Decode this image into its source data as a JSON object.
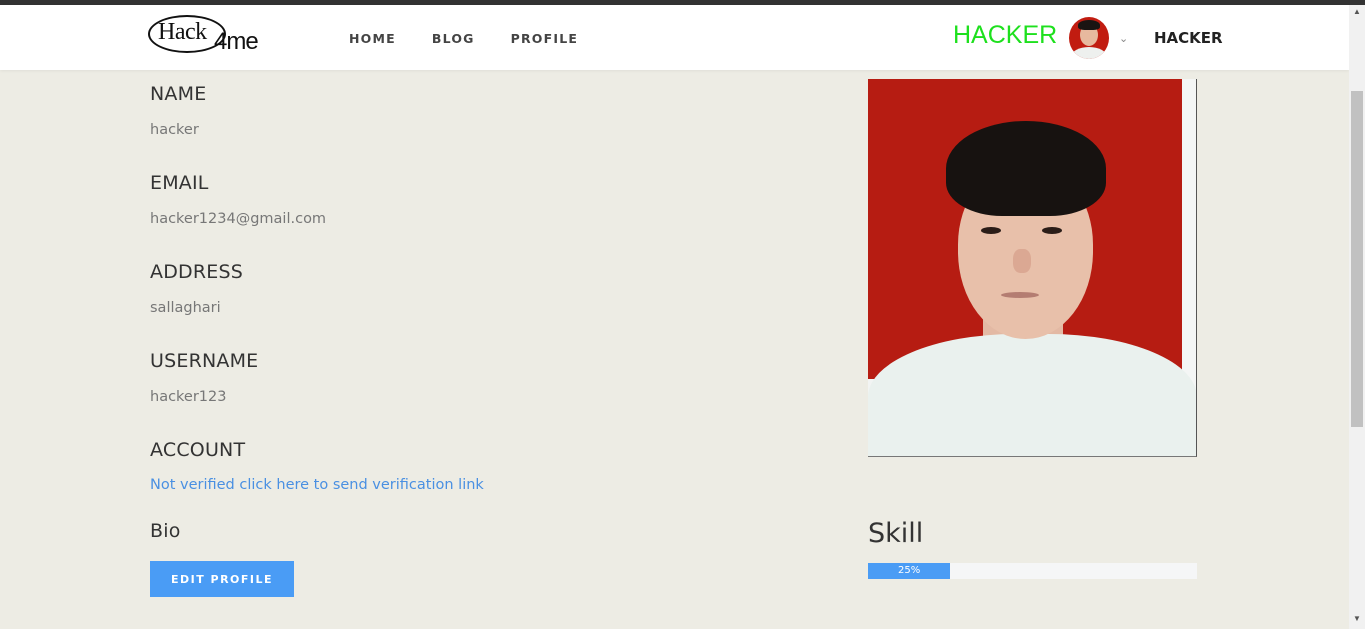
{
  "navbar": {
    "logo": {
      "part1": "Hack",
      "part2": "4me"
    },
    "links": [
      "HOME",
      "BLOG",
      "PROFILE"
    ],
    "brand_user": "HACKER",
    "username": "HACKER",
    "caret_icon": "chevron-down-icon"
  },
  "profile": {
    "name_label": "NAME",
    "name_value": "hacker",
    "email_label": "EMAIL",
    "email_value": "hacker1234@gmail.com",
    "address_label": "ADDRESS",
    "address_value": "sallaghari",
    "username_label": "USERNAME",
    "username_value": "hacker123",
    "account_label": "ACCOUNT",
    "account_link": "Not verified click here to send verification link",
    "bio_label": "Bio",
    "edit_button": "EDIT PROFILE"
  },
  "skill": {
    "title": "Skill",
    "progress_percent": 25,
    "progress_label": "25%"
  },
  "colors": {
    "background": "#edece4",
    "accent": "#4a9cf5",
    "brand_user": "#1ee01e",
    "link": "#4a90e2"
  }
}
